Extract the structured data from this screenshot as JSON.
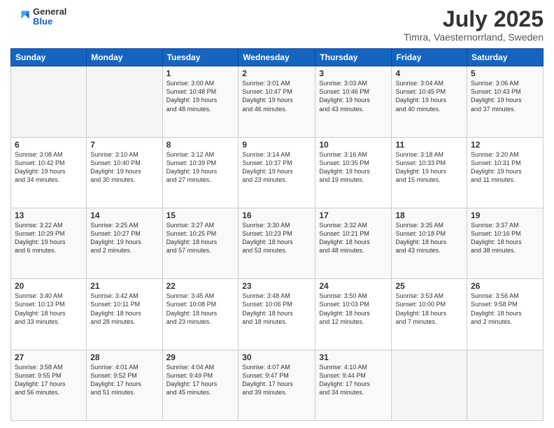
{
  "header": {
    "logo_general": "General",
    "logo_blue": "Blue",
    "month_title": "July 2025",
    "location": "Timra, Vaesternorrland, Sweden"
  },
  "calendar": {
    "days_of_week": [
      "Sunday",
      "Monday",
      "Tuesday",
      "Wednesday",
      "Thursday",
      "Friday",
      "Saturday"
    ],
    "weeks": [
      [
        {
          "day": "",
          "detail": ""
        },
        {
          "day": "",
          "detail": ""
        },
        {
          "day": "1",
          "detail": "Sunrise: 3:00 AM\nSunset: 10:48 PM\nDaylight: 19 hours\nand 48 minutes."
        },
        {
          "day": "2",
          "detail": "Sunrise: 3:01 AM\nSunset: 10:47 PM\nDaylight: 19 hours\nand 46 minutes."
        },
        {
          "day": "3",
          "detail": "Sunrise: 3:03 AM\nSunset: 10:46 PM\nDaylight: 19 hours\nand 43 minutes."
        },
        {
          "day": "4",
          "detail": "Sunrise: 3:04 AM\nSunset: 10:45 PM\nDaylight: 19 hours\nand 40 minutes."
        },
        {
          "day": "5",
          "detail": "Sunrise: 3:06 AM\nSunset: 10:43 PM\nDaylight: 19 hours\nand 37 minutes."
        }
      ],
      [
        {
          "day": "6",
          "detail": "Sunrise: 3:08 AM\nSunset: 10:42 PM\nDaylight: 19 hours\nand 34 minutes."
        },
        {
          "day": "7",
          "detail": "Sunrise: 3:10 AM\nSunset: 10:40 PM\nDaylight: 19 hours\nand 30 minutes."
        },
        {
          "day": "8",
          "detail": "Sunrise: 3:12 AM\nSunset: 10:39 PM\nDaylight: 19 hours\nand 27 minutes."
        },
        {
          "day": "9",
          "detail": "Sunrise: 3:14 AM\nSunset: 10:37 PM\nDaylight: 19 hours\nand 23 minutes."
        },
        {
          "day": "10",
          "detail": "Sunrise: 3:16 AM\nSunset: 10:35 PM\nDaylight: 19 hours\nand 19 minutes."
        },
        {
          "day": "11",
          "detail": "Sunrise: 3:18 AM\nSunset: 10:33 PM\nDaylight: 19 hours\nand 15 minutes."
        },
        {
          "day": "12",
          "detail": "Sunrise: 3:20 AM\nSunset: 10:31 PM\nDaylight: 19 hours\nand 11 minutes."
        }
      ],
      [
        {
          "day": "13",
          "detail": "Sunrise: 3:22 AM\nSunset: 10:29 PM\nDaylight: 19 hours\nand 6 minutes."
        },
        {
          "day": "14",
          "detail": "Sunrise: 3:25 AM\nSunset: 10:27 PM\nDaylight: 19 hours\nand 2 minutes."
        },
        {
          "day": "15",
          "detail": "Sunrise: 3:27 AM\nSunset: 10:25 PM\nDaylight: 18 hours\nand 57 minutes."
        },
        {
          "day": "16",
          "detail": "Sunrise: 3:30 AM\nSunset: 10:23 PM\nDaylight: 18 hours\nand 53 minutes."
        },
        {
          "day": "17",
          "detail": "Sunrise: 3:32 AM\nSunset: 10:21 PM\nDaylight: 18 hours\nand 48 minutes."
        },
        {
          "day": "18",
          "detail": "Sunrise: 3:35 AM\nSunset: 10:18 PM\nDaylight: 18 hours\nand 43 minutes."
        },
        {
          "day": "19",
          "detail": "Sunrise: 3:37 AM\nSunset: 10:16 PM\nDaylight: 18 hours\nand 38 minutes."
        }
      ],
      [
        {
          "day": "20",
          "detail": "Sunrise: 3:40 AM\nSunset: 10:13 PM\nDaylight: 18 hours\nand 33 minutes."
        },
        {
          "day": "21",
          "detail": "Sunrise: 3:42 AM\nSunset: 10:11 PM\nDaylight: 18 hours\nand 28 minutes."
        },
        {
          "day": "22",
          "detail": "Sunrise: 3:45 AM\nSunset: 10:08 PM\nDaylight: 18 hours\nand 23 minutes."
        },
        {
          "day": "23",
          "detail": "Sunrise: 3:48 AM\nSunset: 10:06 PM\nDaylight: 18 hours\nand 18 minutes."
        },
        {
          "day": "24",
          "detail": "Sunrise: 3:50 AM\nSunset: 10:03 PM\nDaylight: 18 hours\nand 12 minutes."
        },
        {
          "day": "25",
          "detail": "Sunrise: 3:53 AM\nSunset: 10:00 PM\nDaylight: 18 hours\nand 7 minutes."
        },
        {
          "day": "26",
          "detail": "Sunrise: 3:56 AM\nSunset: 9:58 PM\nDaylight: 18 hours\nand 2 minutes."
        }
      ],
      [
        {
          "day": "27",
          "detail": "Sunrise: 3:58 AM\nSunset: 9:55 PM\nDaylight: 17 hours\nand 56 minutes."
        },
        {
          "day": "28",
          "detail": "Sunrise: 4:01 AM\nSunset: 9:52 PM\nDaylight: 17 hours\nand 51 minutes."
        },
        {
          "day": "29",
          "detail": "Sunrise: 4:04 AM\nSunset: 9:49 PM\nDaylight: 17 hours\nand 45 minutes."
        },
        {
          "day": "30",
          "detail": "Sunrise: 4:07 AM\nSunset: 9:47 PM\nDaylight: 17 hours\nand 39 minutes."
        },
        {
          "day": "31",
          "detail": "Sunrise: 4:10 AM\nSunset: 9:44 PM\nDaylight: 17 hours\nand 34 minutes."
        },
        {
          "day": "",
          "detail": ""
        },
        {
          "day": "",
          "detail": ""
        }
      ]
    ]
  }
}
